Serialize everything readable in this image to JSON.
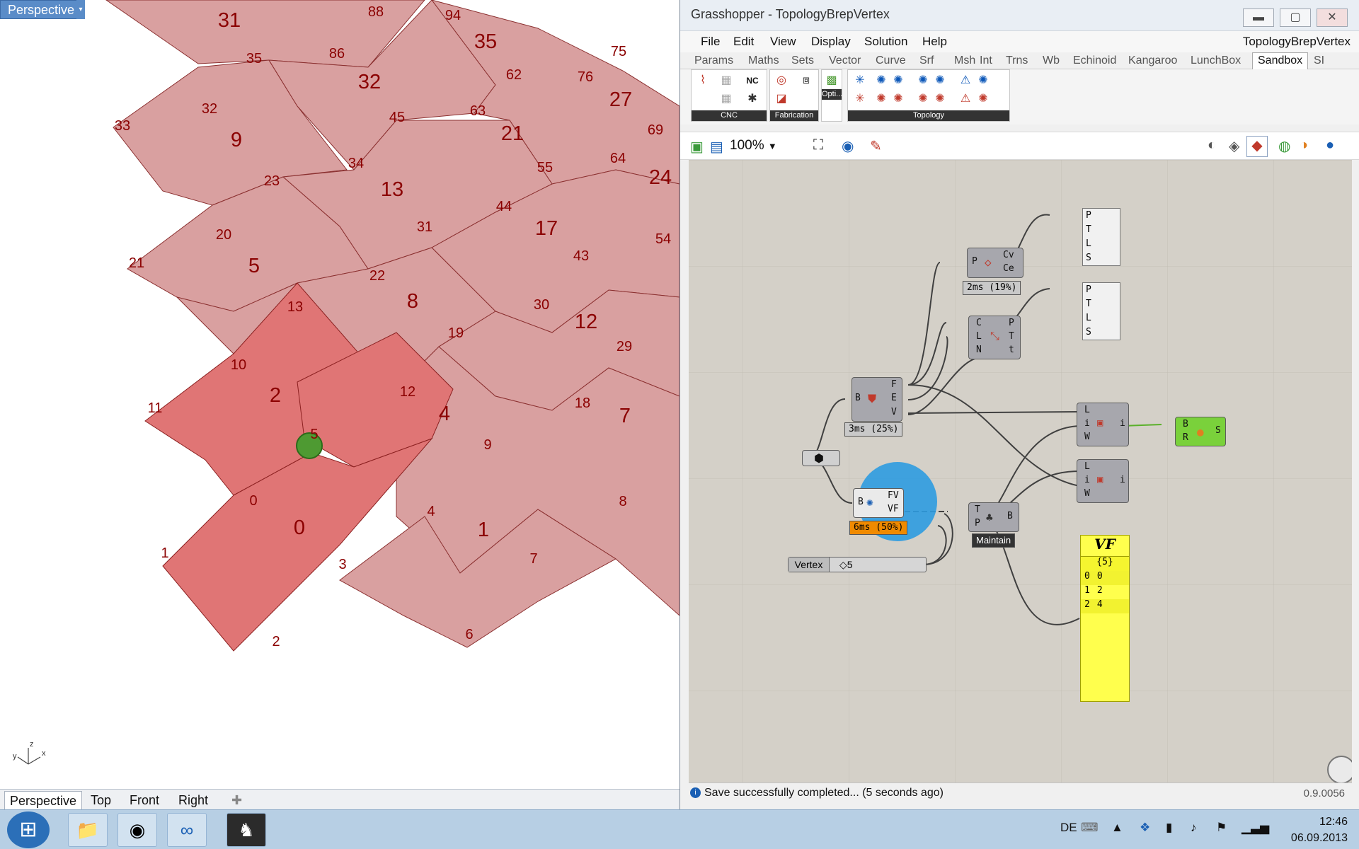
{
  "rhino": {
    "viewport_label": "Perspective",
    "viewport_tabs": [
      "Perspective",
      "Top",
      "Front",
      "Right"
    ],
    "axes": {
      "z": "z",
      "y": "y",
      "x": "x"
    },
    "face_labels": [
      "31",
      "32",
      "35",
      "9",
      "27",
      "21",
      "13",
      "24",
      "5",
      "17",
      "8",
      "12",
      "2",
      "4",
      "7",
      "0",
      "1"
    ],
    "vertex_labels": [
      "88",
      "94",
      "75",
      "35",
      "86",
      "62",
      "76",
      "32",
      "45",
      "63",
      "69",
      "33",
      "34",
      "64",
      "23",
      "55",
      "20",
      "31",
      "44",
      "54",
      "21",
      "43",
      "22",
      "13",
      "30",
      "19",
      "29",
      "10",
      "12",
      "18",
      "11",
      "9",
      "5",
      "0",
      "8",
      "4",
      "1",
      "3",
      "7",
      "2",
      "6"
    ]
  },
  "gh": {
    "title": "Grasshopper - TopologyBrepVertex",
    "document_name": "TopologyBrepVertex",
    "window_buttons": {
      "minimize": "▬",
      "restore": "▢",
      "close": "✕"
    },
    "menus": [
      "File",
      "Edit",
      "View",
      "Display",
      "Solution",
      "Help"
    ],
    "tabs": [
      "Params",
      "Maths",
      "Sets",
      "Vector",
      "Curve",
      "Srf",
      "Msh",
      "Int",
      "Trns",
      "Wb",
      "Echinoid",
      "Kangaroo",
      "LunchBox",
      "Sandbox",
      "SI"
    ],
    "active_tab": "Sandbox",
    "ribbon_groups": [
      "CNC",
      "Fabrication",
      "Opti...",
      "Topology"
    ],
    "zoom": "100%",
    "components": {
      "brep_param": "",
      "deconstruct": {
        "in": [
          "B"
        ],
        "out": [
          "F",
          "E",
          "V"
        ],
        "timer": "3ms (25%)"
      },
      "curve_params": {
        "in": [
          "P"
        ],
        "out": [
          "Cv",
          "Ce"
        ],
        "timer": "2ms (19%)"
      },
      "evaluate": {
        "in": [
          "C",
          "L",
          "N"
        ],
        "out": [
          "P",
          "T",
          "t"
        ]
      },
      "topology": {
        "in": [
          "B"
        ],
        "out": [
          "FV",
          "VF"
        ],
        "timer": "6ms (50%)"
      },
      "list_top": {
        "in": [
          "L",
          "i",
          "W"
        ],
        "out": [
          "i"
        ]
      },
      "list_bottom": {
        "in": [
          "L",
          "i",
          "W"
        ],
        "out": [
          "i"
        ]
      },
      "tree": {
        "in": [
          "T",
          "P"
        ],
        "out": [
          "B"
        ],
        "label": "Maintain"
      },
      "preview": {
        "in": [
          "B",
          "R"
        ],
        "out": [
          "S"
        ]
      },
      "panel1": [
        "P",
        "T",
        "L",
        "S"
      ],
      "panel2": [
        "P",
        "T",
        "L",
        "S"
      ],
      "slider": {
        "label": "Vertex",
        "value": "◇5"
      },
      "vf_panel": {
        "title": "VF",
        "path": "{5}",
        "rows": [
          [
            "0",
            "0"
          ],
          [
            "1",
            "2"
          ],
          [
            "2",
            "4"
          ]
        ]
      }
    },
    "status": "Save successfully completed... (5 seconds ago)",
    "version": "0.9.0056"
  },
  "taskbar": {
    "lang": "DE",
    "time": "12:46",
    "date": "06.09.2013"
  },
  "colors": {
    "face": "#d9a0a0",
    "face_highlight": "#e48080",
    "edge": "#8b2020",
    "label": "#8b0000",
    "gh_canvas": "#d4d0c8",
    "vf_panel": "#ffff4d"
  }
}
